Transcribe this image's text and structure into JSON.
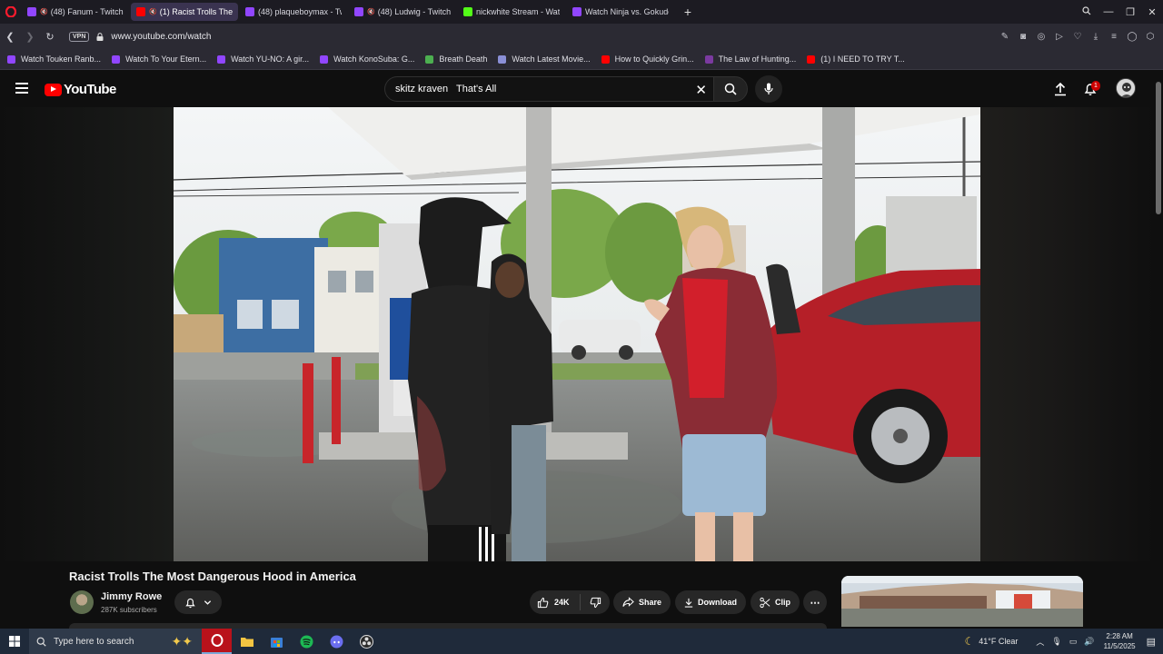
{
  "browser": {
    "tabs": [
      {
        "label": "(48) Fanum - Twitch",
        "muted": true,
        "color": "#9146ff"
      },
      {
        "label": "(1) Racist Trolls The M",
        "muted": true,
        "color": "#ff0000"
      },
      {
        "label": "(48) plaqueboymax - Twi",
        "muted": false,
        "color": "#9146ff"
      },
      {
        "label": "(48) Ludwig - Twitch",
        "muted": true,
        "color": "#9146ff"
      },
      {
        "label": "nickwhite Stream - Watch",
        "muted": false,
        "color": "#53fc18"
      },
      {
        "label": "Watch Ninja vs. Gokudo o",
        "muted": false,
        "color": "#9146ff"
      }
    ],
    "url": "www.youtube.com/watch",
    "vpn_label": "VPN",
    "bookmarks": [
      {
        "label": "Watch Touken Ranb...",
        "color": "#9146ff"
      },
      {
        "label": "Watch To Your Etern...",
        "color": "#9146ff"
      },
      {
        "label": "Watch YU-NO: A gir...",
        "color": "#9146ff"
      },
      {
        "label": "Watch KonoSuba: G...",
        "color": "#9146ff"
      },
      {
        "label": "Breath Death",
        "color": "#4caf50"
      },
      {
        "label": "Watch Latest Movie...",
        "color": "#8a8fd6"
      },
      {
        "label": "How to Quickly Grin...",
        "color": "#ff0000"
      },
      {
        "label": "The Law of Hunting...",
        "color": "#7b3aa0"
      },
      {
        "label": "(1) I NEED TO TRY T...",
        "color": "#ff0000"
      }
    ]
  },
  "youtube": {
    "logo_text": "YouTube",
    "search_query": "skitz kraven   That's All",
    "notification_count": "1",
    "video": {
      "title": "Racist Trolls The Most Dangerous Hood in America",
      "channel": "Jimmy Rowe",
      "subscribers": "287K subscribers",
      "likes": "24K",
      "share_label": "Share",
      "download_label": "Download",
      "clip_label": "Clip"
    }
  },
  "taskbar": {
    "search_placeholder": "Type here to search",
    "weather": "41°F  Clear",
    "time": "2:28 AM",
    "date": "11/5/2025"
  }
}
